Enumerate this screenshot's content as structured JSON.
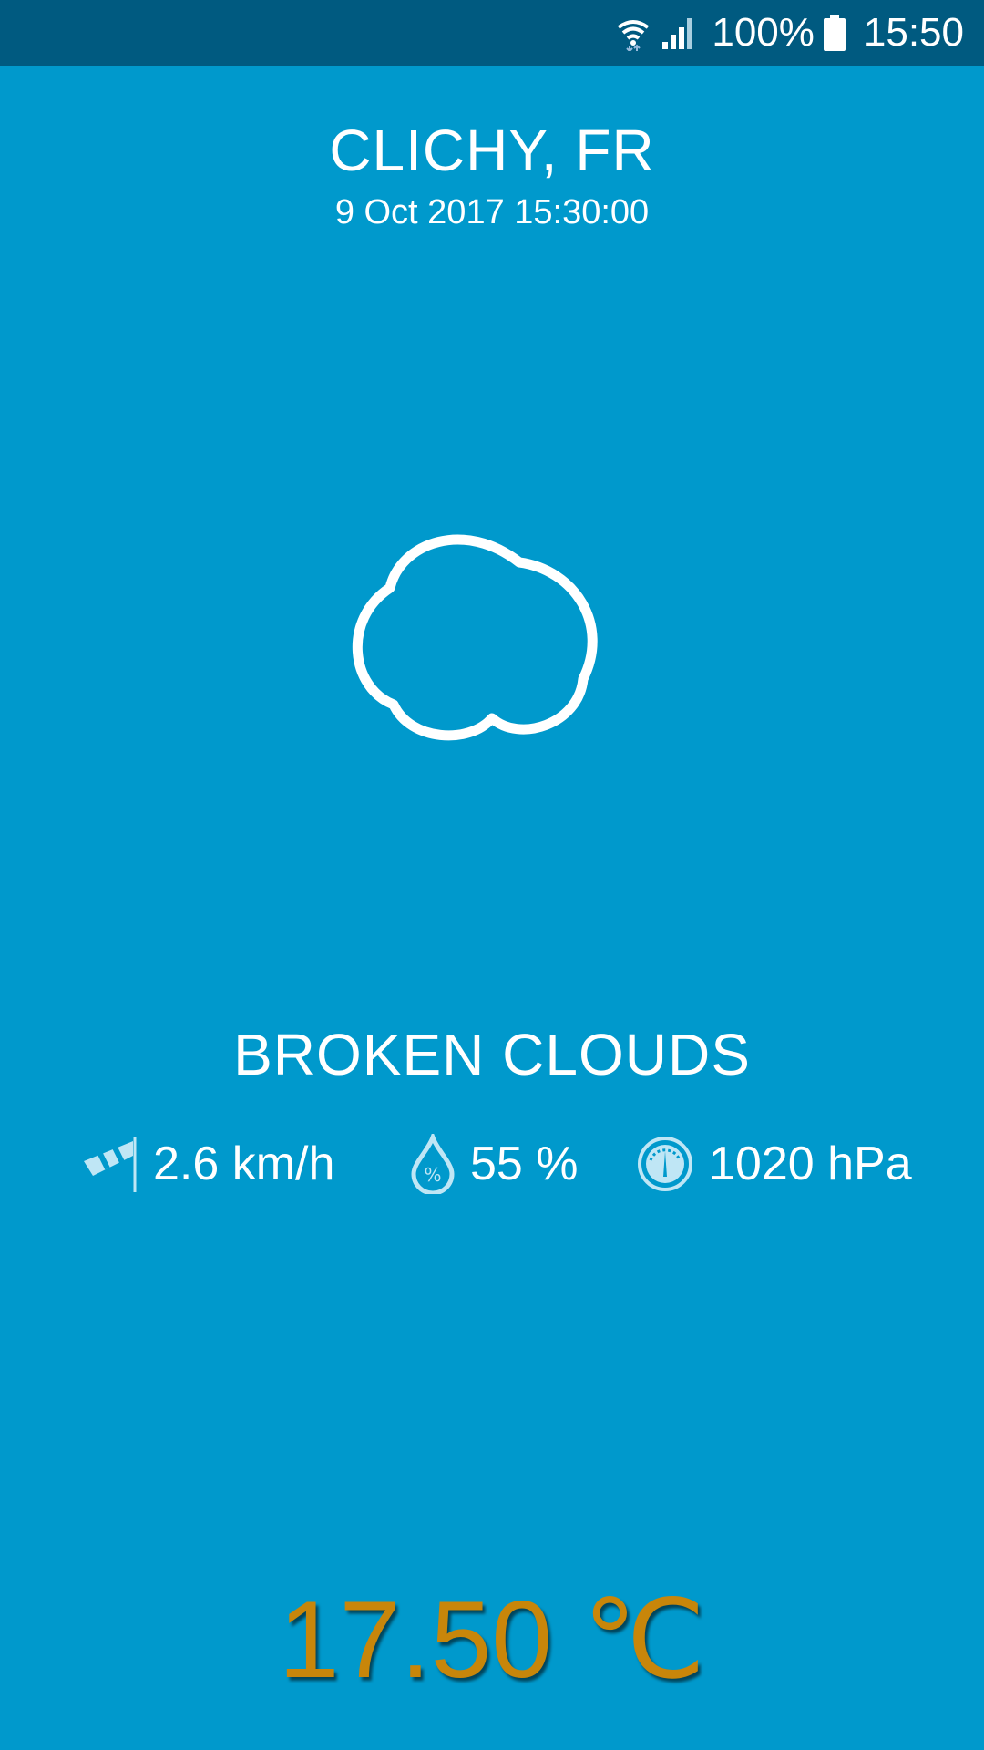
{
  "status_bar": {
    "battery": "100%",
    "time": "15:50",
    "icons": [
      "wifi-icon",
      "signal-icon",
      "battery-icon"
    ]
  },
  "location": {
    "city": "CLICHY, FR",
    "datetime": "9 Oct 2017 15:30:00"
  },
  "weather": {
    "icon": "cloud-icon",
    "description": "BROKEN CLOUDS",
    "wind": "2.6 km/h",
    "humidity": "55 %",
    "pressure": "1020 hPa",
    "temperature": "17.50 ℃"
  },
  "colors": {
    "background": "#0099cc",
    "status_bar": "#005a80",
    "temperature": "#c8860a",
    "icon_light": "#bfe6f5"
  }
}
